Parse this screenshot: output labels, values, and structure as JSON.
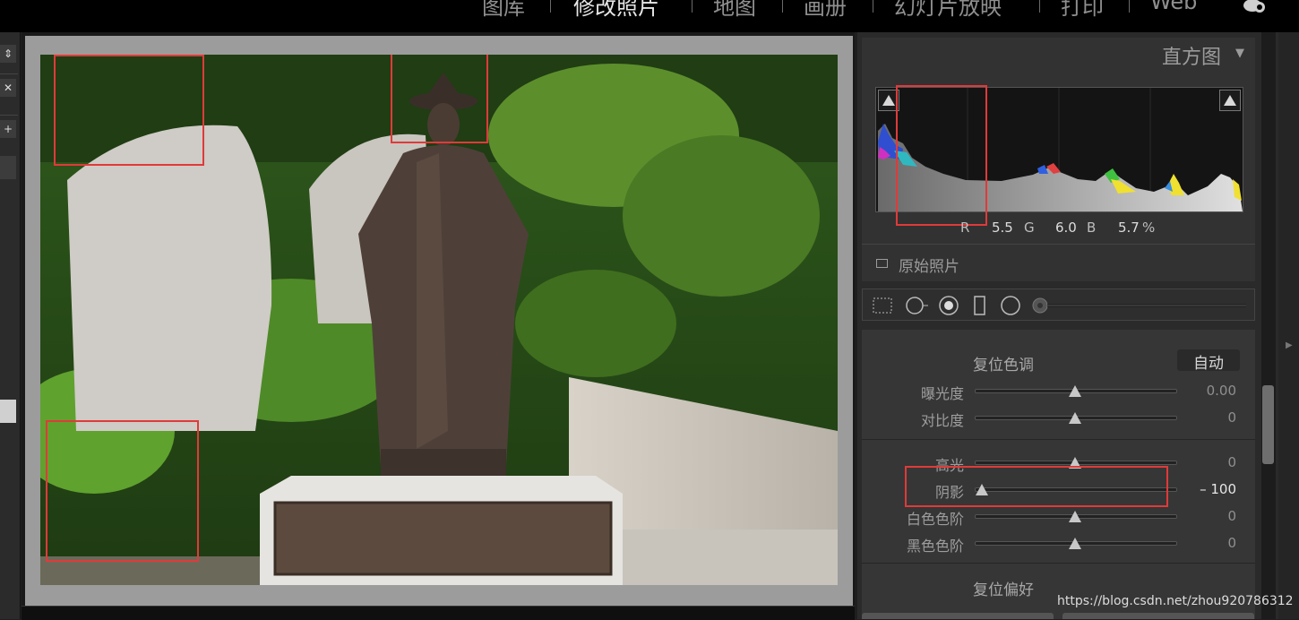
{
  "modules": [
    {
      "label": "图库",
      "active": false
    },
    {
      "label": "修改照片",
      "active": true
    },
    {
      "label": "地图",
      "active": false
    },
    {
      "label": "画册",
      "active": false
    },
    {
      "label": "幻灯片放映",
      "active": false
    },
    {
      "label": "打印",
      "active": false
    },
    {
      "label": "Web",
      "active": false
    }
  ],
  "histogram": {
    "title": "直方图",
    "r_label": "R",
    "r_value": "5.5",
    "g_label": "G",
    "g_value": "6.0",
    "b_label": "B",
    "b_value": "5.7",
    "percent": "%",
    "original_photo_label": "原始照片"
  },
  "basic": {
    "reset_tone_label": "复位色调",
    "auto_label": "自动",
    "reset_pref_label": "复位偏好",
    "sliders": [
      {
        "label": "曝光度",
        "value": "0.00",
        "position": 0.5
      },
      {
        "label": "对比度",
        "value": "0",
        "position": 0.5
      },
      {
        "label": "高光",
        "value": "0",
        "position": 0.5
      },
      {
        "label": "阴影",
        "value": "– 100",
        "position": 0.0
      },
      {
        "label": "白色色阶",
        "value": "0",
        "position": 0.5
      },
      {
        "label": "黑色色阶",
        "value": "0",
        "position": 0.5
      }
    ]
  },
  "watermark": "https://blog.csdn.net/zhou920786312",
  "colors": {
    "annotation_red": "#e03a3a",
    "panel_bg": "#363636",
    "topbar_bg": "#000000"
  },
  "icons": [
    "cloud-status-icon",
    "crop-overlay-icon",
    "spot-removal-icon",
    "red-eye-icon",
    "graduated-filter-icon",
    "radial-filter-icon",
    "adjustment-brush-icon"
  ]
}
